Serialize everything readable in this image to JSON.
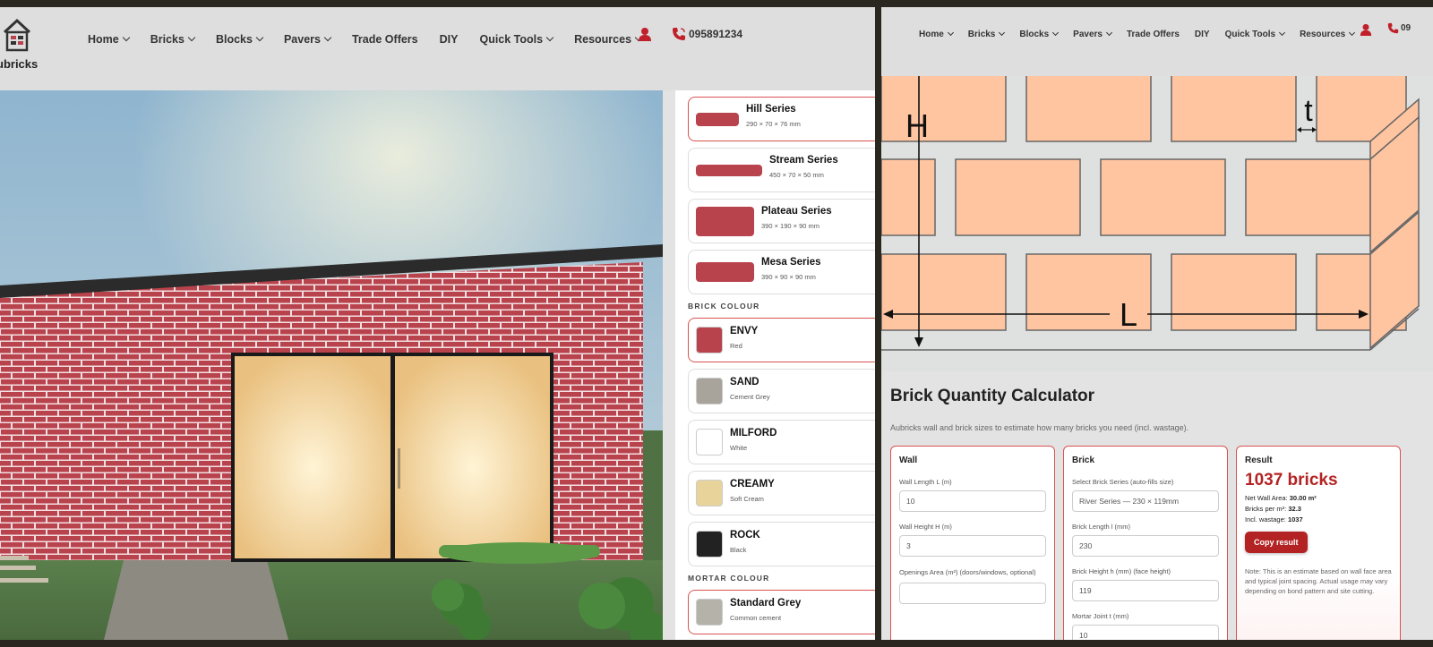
{
  "left_nav": {
    "logo_text": "ubricks",
    "items": [
      {
        "label": "Home",
        "dropdown": true
      },
      {
        "label": "Bricks",
        "dropdown": true
      },
      {
        "label": "Blocks",
        "dropdown": true
      },
      {
        "label": "Pavers",
        "dropdown": true
      },
      {
        "label": "Trade Offers",
        "dropdown": false
      },
      {
        "label": "DIY",
        "dropdown": false
      },
      {
        "label": "Quick Tools",
        "dropdown": true
      },
      {
        "label": "Resources",
        "dropdown": true
      }
    ],
    "phone": "095891234"
  },
  "right_nav": {
    "items": [
      "Home",
      "Bricks",
      "Blocks",
      "Pavers",
      "Trade Offers",
      "DIY",
      "Quick Tools",
      "Resources"
    ],
    "phone_partial": "09"
  },
  "series": [
    {
      "name": "Hill Series",
      "size": "290 × 70 × 76 mm",
      "color": "#b9434d",
      "selected": true
    },
    {
      "name": "Stream Series",
      "size": "450 × 70 × 50 mm",
      "color": "#b9434d",
      "selected": false
    },
    {
      "name": "Plateau Series",
      "size": "390 × 190 × 90 mm",
      "color": "#b9434d",
      "selected": false
    },
    {
      "name": "Mesa Series",
      "size": "390 × 90 × 90 mm",
      "color": "#b9434d",
      "selected": false
    }
  ],
  "brick_colour_heading": "BRICK COLOUR",
  "brick_colours": [
    {
      "name": "ENVY",
      "sub": "Red",
      "color": "#b9434d",
      "selected": true
    },
    {
      "name": "SAND",
      "sub": "Cement Grey",
      "color": "#a8a39b",
      "selected": false
    },
    {
      "name": "MILFORD",
      "sub": "White",
      "color": "#ffffff",
      "selected": false
    },
    {
      "name": "CREAMY",
      "sub": "Soft Cream",
      "color": "#e8d49a",
      "selected": false
    },
    {
      "name": "ROCK",
      "sub": "Black",
      "color": "#222222",
      "selected": false
    }
  ],
  "mortar_colour_heading": "MORTAR COLOUR",
  "mortar_colours": [
    {
      "name": "Standard Grey",
      "sub": "Common cement",
      "color": "#b5b2aa",
      "selected": true
    }
  ],
  "diagram": {
    "h_label": "H",
    "l_label": "L",
    "t_label": "t"
  },
  "calculator": {
    "title": "Brick Quantity Calculator",
    "description": "Aubricks wall and brick sizes to estimate how many bricks you need (incl. wastage).",
    "wall": {
      "heading": "Wall",
      "length_label": "Wall Length L (m)",
      "length_value": "10",
      "height_label": "Wall Height H (m)",
      "height_value": "3",
      "openings_label": "Openings Area (m²)   (doors/windows, optional)",
      "openings_value": ""
    },
    "brick": {
      "heading": "Brick",
      "series_label": "Select Brick Series   (auto-fills size)",
      "series_value": "River Series — 230 × 119mm",
      "length_label": "Brick Length l (mm)",
      "length_value": "230",
      "height_label": "Brick Height h (mm)   (face height)",
      "height_value": "119",
      "joint_label": "Mortar Joint t (mm)",
      "joint_value": "10"
    },
    "result": {
      "heading": "Result",
      "count": "1037 bricks",
      "net_area_label": "Net Wall Area:",
      "net_area_value": "30.00 m²",
      "per_m2_label": "Bricks per m²:",
      "per_m2_value": "32.3",
      "wastage_label": "Incl. wastage:",
      "wastage_value": "1037",
      "copy_label": "Copy result",
      "note": "Note: This is an estimate based on wall face area and typical joint spacing. Actual usage may vary depending on bond pattern and site cutting."
    }
  }
}
